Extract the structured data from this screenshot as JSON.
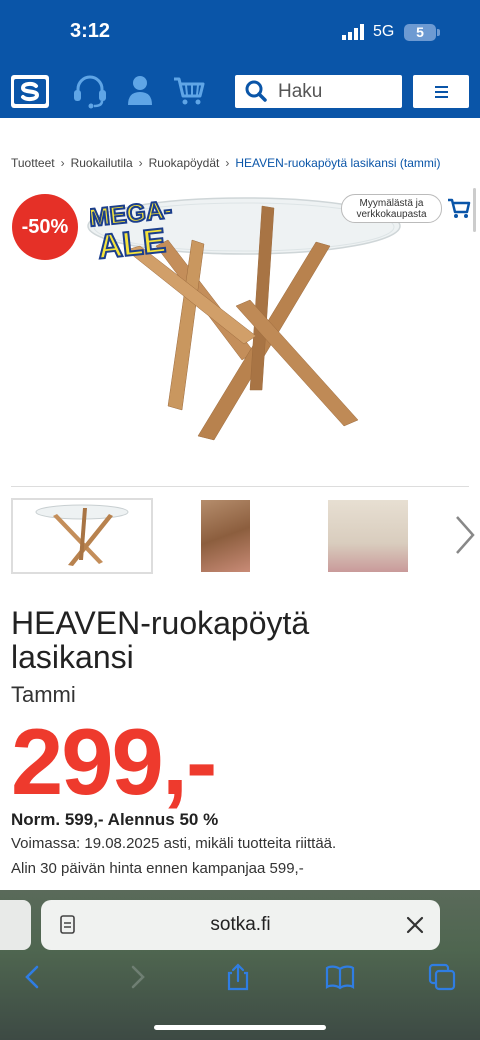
{
  "status_bar": {
    "time": "3:12",
    "network": "5G",
    "battery": "5"
  },
  "header": {
    "search_placeholder": "Haku",
    "icons": [
      "sotka-logo",
      "headset-icon",
      "user-icon",
      "cart-icon",
      "search-icon",
      "menu-icon"
    ]
  },
  "breadcrumb": [
    {
      "label": "Tuotteet"
    },
    {
      "label": "Ruokailutila"
    },
    {
      "label": "Ruokapöydät"
    },
    {
      "label": "HEAVEN-ruokapöytä lasikansi (tammi)"
    }
  ],
  "badges": {
    "discount": "-50%",
    "mega_line1": "MEGA-",
    "mega_line2": "ALE"
  },
  "availability": {
    "line1": "Myymälästä ja",
    "line2": "verkkokaupasta"
  },
  "product": {
    "title_line1": "HEAVEN-ruokapöytä",
    "title_line2": "lasikansi",
    "variant": "Tammi",
    "price": "299,-",
    "normal_price": "Norm. 599,- Alennus 50 %",
    "valid_until": "Voimassa: 19.08.2025 asti, mikäli tuotteita riittää.",
    "lowest_price_note": "Alin 30 päivän hinta ennen kampanjaa 599,-"
  },
  "gallery": {
    "thumbnails": 3,
    "selected": 1
  },
  "browser": {
    "url": "sotka.fi"
  },
  "colors": {
    "brand_blue": "#0a55a8",
    "sale_red": "#ee3a2d",
    "mega_yellow": "#f5e33b"
  }
}
